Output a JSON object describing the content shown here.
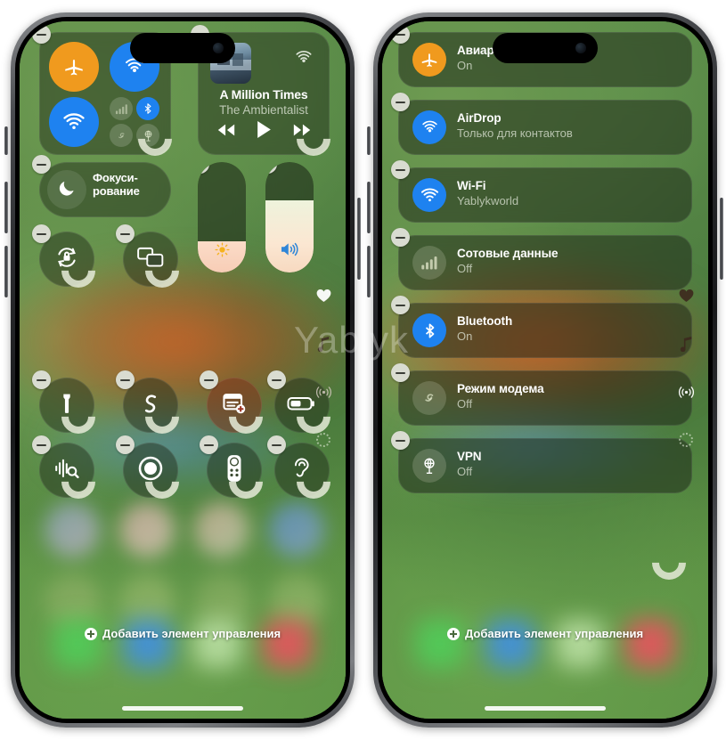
{
  "watermark": "Yablyk",
  "footer": {
    "add_control_label": "Добавить элемент управления"
  },
  "left_phone": {
    "connectivity": {
      "toggles": [
        {
          "name": "airplane-mode",
          "icon": "airplane-icon",
          "state": "on",
          "color": "#f09a1e"
        },
        {
          "name": "airdrop",
          "icon": "airdrop-icon",
          "state": "on",
          "color": "#1e82f0"
        },
        {
          "name": "wifi",
          "icon": "wifi-icon",
          "state": "on",
          "color": "#1e82f0"
        },
        {
          "name": "cellular-data",
          "icon": "cellular-icon",
          "state": "off",
          "color": "#2b3526"
        },
        {
          "name": "bluetooth",
          "icon": "bluetooth-icon",
          "state": "on",
          "color": "#1e82f0"
        },
        {
          "name": "personal-hotspot",
          "icon": "hotspot-icon",
          "state": "off",
          "color": "#2b3526"
        },
        {
          "name": "vpn",
          "icon": "vpn-icon",
          "state": "off",
          "color": "#2b3526"
        }
      ]
    },
    "now_playing": {
      "track_title": "A Million Times",
      "artist": "The Ambientalist",
      "airplay_icon": "airplay-icon",
      "controls": [
        "rewind-icon",
        "play-icon",
        "fastforward-icon"
      ]
    },
    "tiles": [
      {
        "name": "rotation-lock",
        "icon": "rotation-lock-icon"
      },
      {
        "name": "screen-mirroring",
        "icon": "screen-mirroring-icon"
      }
    ],
    "focus": {
      "label_line1": "Фокуси-",
      "label_line2": "рование",
      "icon": "moon-icon"
    },
    "sliders": [
      {
        "name": "brightness",
        "icon": "sun-icon",
        "value": 28
      },
      {
        "name": "volume",
        "icon": "speaker-icon",
        "value": 65
      }
    ],
    "control_row_1": [
      {
        "name": "flashlight",
        "icon": "flashlight-icon",
        "accent": "dark"
      },
      {
        "name": "shazam",
        "icon": "shazam-icon",
        "accent": "dark"
      },
      {
        "name": "notes",
        "icon": "notes-add-icon",
        "accent": "red"
      },
      {
        "name": "low-power-mode",
        "icon": "battery-icon",
        "accent": "dark"
      }
    ],
    "control_row_2": [
      {
        "name": "sound-recognition",
        "icon": "sound-recognition-icon",
        "accent": "dark"
      },
      {
        "name": "screen-record",
        "icon": "screen-record-icon",
        "accent": "dark"
      },
      {
        "name": "apple-tv-remote",
        "icon": "remote-icon",
        "accent": "dark"
      },
      {
        "name": "hearing",
        "icon": "hearing-icon",
        "accent": "dark"
      }
    ],
    "rail_icons": [
      "heart-icon",
      "music-note-icon",
      "connectivity-icon",
      "page-dot-icon"
    ]
  },
  "right_phone": {
    "rows": [
      {
        "name": "airplane-mode",
        "label": "Авиарежим",
        "state": "On",
        "icon": "airplane-icon",
        "color": "#f09a1e"
      },
      {
        "name": "airdrop",
        "label": "AirDrop",
        "state": "Только для контактов",
        "icon": "airdrop-icon",
        "color": "#1e82f0"
      },
      {
        "name": "wifi",
        "label": "Wi-Fi",
        "state": "Yablykworld",
        "icon": "wifi-icon",
        "color": "#1e82f0"
      },
      {
        "name": "cellular-data",
        "label": "Сотовые данные",
        "state": "Off",
        "icon": "cellular-icon",
        "color": "rgba(210,215,190,.22)"
      },
      {
        "name": "bluetooth",
        "label": "Bluetooth",
        "state": "On",
        "icon": "bluetooth-icon",
        "color": "#1e82f0"
      },
      {
        "name": "personal-hotspot",
        "label": "Режим модема",
        "state": "Off",
        "icon": "hotspot-icon",
        "color": "rgba(210,215,190,.22)"
      },
      {
        "name": "vpn",
        "label": "VPN",
        "state": "Off",
        "icon": "vpn-icon",
        "color": "rgba(210,215,190,.22)"
      }
    ],
    "rail_icons": [
      "heart-icon",
      "music-note-icon",
      "connectivity-icon",
      "page-dot-icon"
    ]
  }
}
